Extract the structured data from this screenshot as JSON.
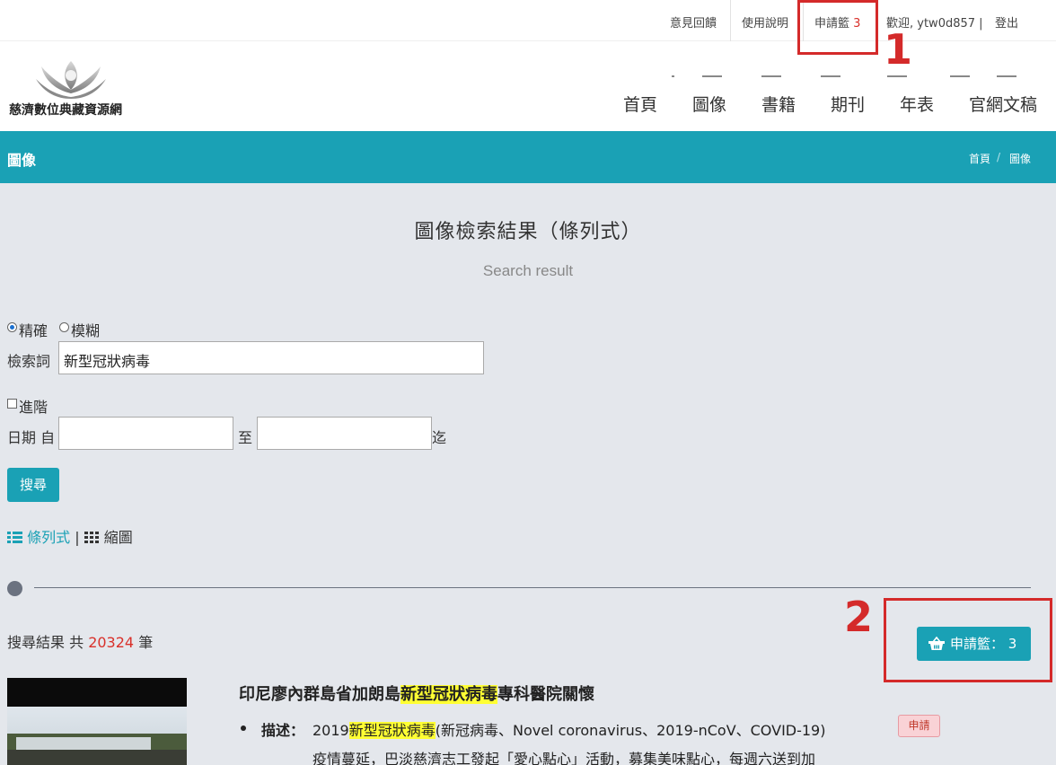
{
  "topbar": {
    "feedback": "意見回饋",
    "help": "使用說明",
    "cart_label": "申請籃",
    "cart_count": "3",
    "welcome": "歡迎, ytw0d857 |",
    "logout": "登出"
  },
  "brand": {
    "site_name": "慈濟數位典藏資源網"
  },
  "nav": {
    "items": [
      "首頁",
      "圖像",
      "書籍",
      "期刊",
      "年表",
      "官網文稿"
    ]
  },
  "section_bar": {
    "title": "圖像",
    "breadcrumb": [
      "首頁",
      "/",
      "圖像"
    ]
  },
  "page": {
    "heading": "圖像檢索結果（條列式）",
    "subheading": "Search result"
  },
  "search": {
    "mode_exact": "精確",
    "mode_fuzzy": "模糊",
    "mode_selected": "exact",
    "keyword_label": "檢索詞",
    "keyword_value": "新型冠狀病毒",
    "advanced_label": "進階",
    "advanced_checked": false,
    "date_label": "日期 自",
    "date_to": "至",
    "date_end": "迄",
    "date_from_value": "",
    "date_to_value": "",
    "submit": "搜尋"
  },
  "view": {
    "list_label": "條列式",
    "separator": "|",
    "grid_label": "縮圖",
    "active": "list"
  },
  "results": {
    "count_prefix": "搜尋結果 共",
    "count": "20324",
    "count_suffix": "筆",
    "cart_button_label": "申請籃：",
    "cart_button_count": "3"
  },
  "annotations": {
    "box1_number": "1",
    "box2_number": "2"
  },
  "item": {
    "title_before": "印尼廖內群島省加朗島",
    "title_highlight": "新型冠狀病毒",
    "title_after": "專科醫院關懷",
    "desc_label": "描述：",
    "desc_line1_before": "2019",
    "desc_line1_highlight": "新型冠狀病毒",
    "desc_line1_after": "(新冠病毒、Novel coronavirus、2019-nCoV、COVID-19)",
    "desc_line2": "疫情蔓延，巴淡慈濟志工發起「愛心點心」活動，募集美味點心，每週六送到加",
    "apply_label": "申請"
  },
  "colors": {
    "teal": "#1aa1b5",
    "highlight": "#ffff33",
    "annotation_red": "#d42a2a",
    "count_red": "#d9302a"
  }
}
